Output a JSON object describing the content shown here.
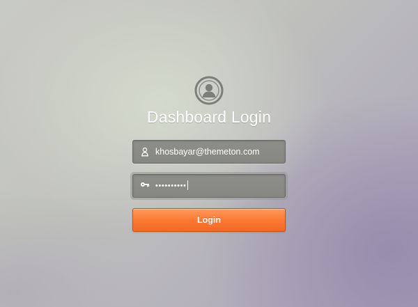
{
  "login": {
    "title": "Dashboard Login",
    "avatar_icon": "user-circle-icon",
    "email": {
      "icon": "user-icon",
      "value": "khosbayar@themeton.com"
    },
    "password": {
      "icon": "key-icon",
      "value": "••••••••••"
    },
    "button_label": "Login"
  },
  "colors": {
    "accent": "#fb7a34",
    "field_bg": "#8a8b87",
    "text": "#ffffff"
  }
}
